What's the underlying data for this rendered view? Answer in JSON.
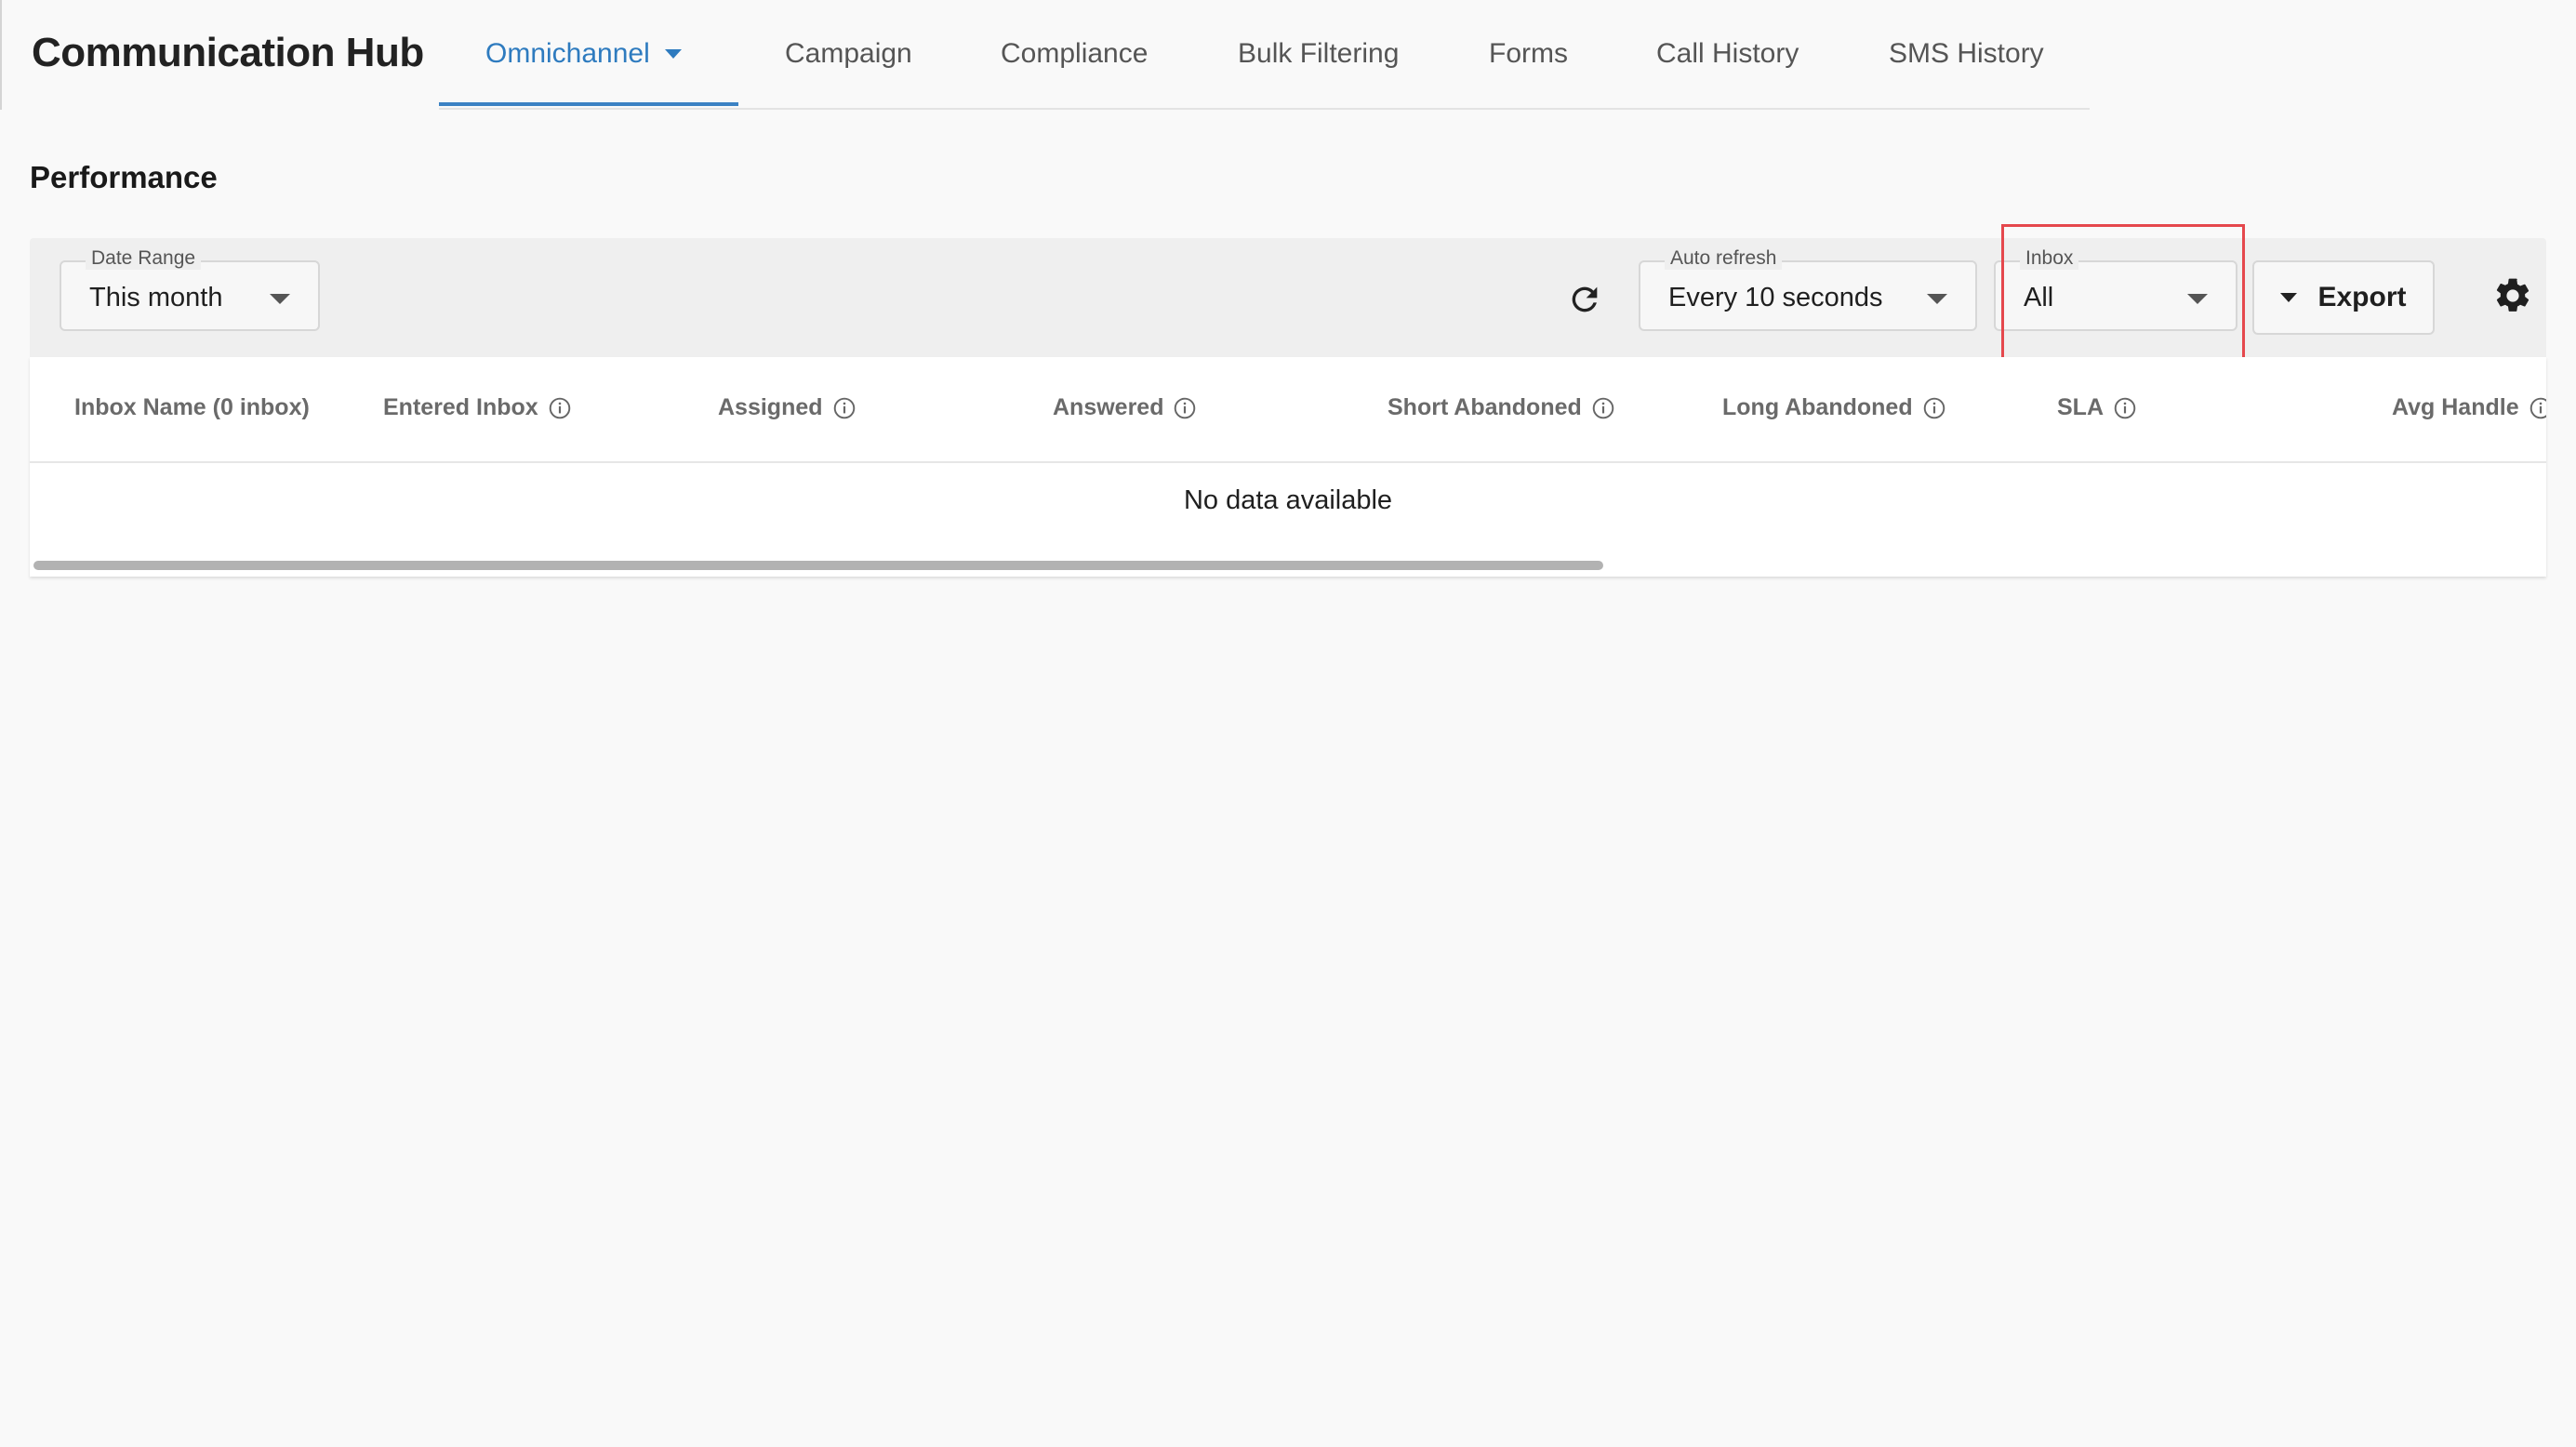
{
  "app": {
    "title": "Communication Hub"
  },
  "tabs": [
    {
      "label": "Omnichannel",
      "active": true
    },
    {
      "label": "Campaign"
    },
    {
      "label": "Compliance"
    },
    {
      "label": "Bulk Filtering"
    },
    {
      "label": "Forms"
    },
    {
      "label": "Call History"
    },
    {
      "label": "SMS History"
    }
  ],
  "section": {
    "title": "Performance"
  },
  "toolbar": {
    "date_range": {
      "label": "Date Range",
      "value": "This month"
    },
    "auto_refresh": {
      "label": "Auto refresh",
      "value": "Every 10 seconds"
    },
    "inbox": {
      "label": "Inbox",
      "value": "All"
    },
    "export_label": "Export",
    "refresh_icon": "refresh-icon",
    "settings_icon": "gear-icon"
  },
  "table": {
    "columns": [
      {
        "label": "Inbox Name (0 inbox)",
        "info": false
      },
      {
        "label": "Entered Inbox",
        "info": true
      },
      {
        "label": "Assigned",
        "info": true
      },
      {
        "label": "Answered",
        "info": true
      },
      {
        "label": "Short Abandoned",
        "info": true
      },
      {
        "label": "Long Abandoned",
        "info": true
      },
      {
        "label": "SLA",
        "info": true
      },
      {
        "label": "Avg Handle",
        "info": true
      }
    ],
    "empty_text": "No data available"
  },
  "colors": {
    "accent": "#2e7bbf",
    "highlight": "#e5484d"
  }
}
